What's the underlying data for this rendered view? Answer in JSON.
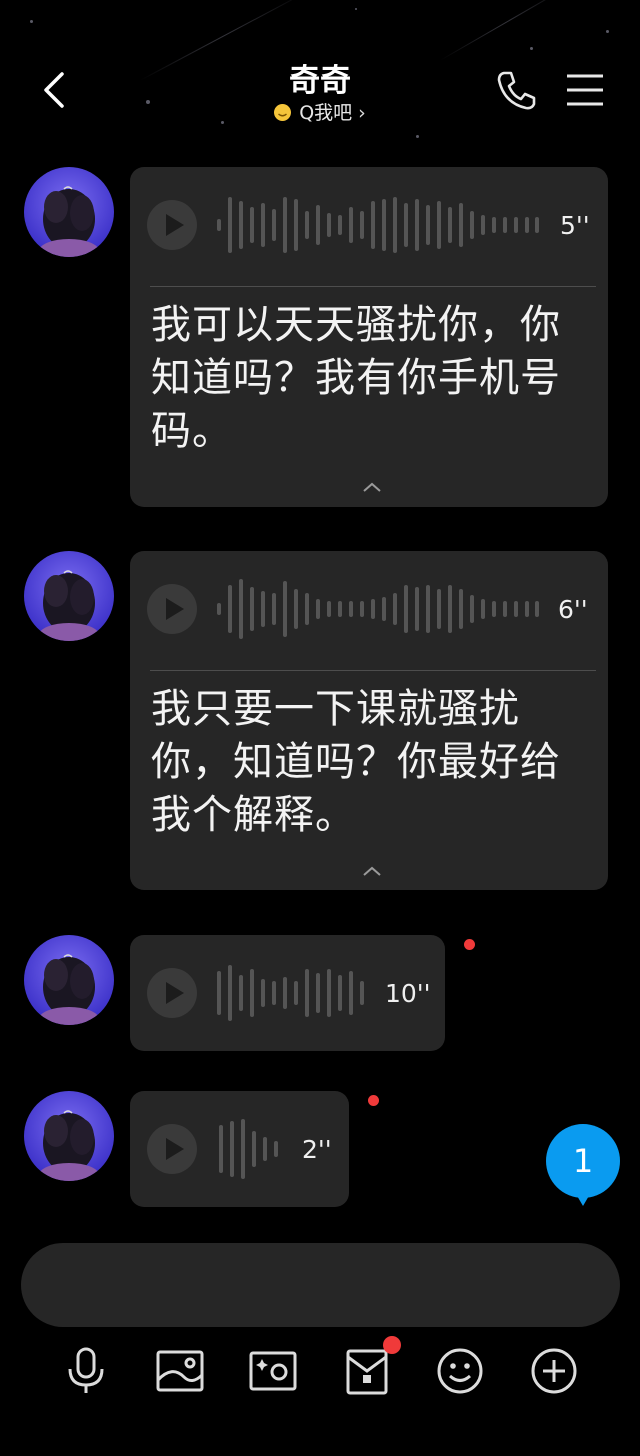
{
  "header": {
    "title": "奇奇",
    "subtitle": "Q我吧",
    "back_icon": "chevron-left-icon",
    "phone_icon": "phone-icon",
    "menu_icon": "hamburger-menu-icon"
  },
  "messages": [
    {
      "type": "voice",
      "duration": "5''",
      "transcript": "我可以天天骚扰你，你知道吗？我有你手机号码。",
      "unread": false
    },
    {
      "type": "voice",
      "duration": "6''",
      "transcript": "我只要一下课就骚扰你，知道吗？你最好给我个解释。",
      "unread": false
    },
    {
      "type": "voice",
      "duration": "10''",
      "transcript": "",
      "unread": true
    },
    {
      "type": "voice",
      "duration": "2''",
      "transcript": "",
      "unread": true
    }
  ],
  "new_message_badge": "1",
  "input": {
    "placeholder": ""
  },
  "toolbar": {
    "items": [
      "microphone-icon",
      "photo-icon",
      "camera-icon",
      "red-packet-icon",
      "emoji-icon",
      "plus-icon"
    ]
  },
  "colors": {
    "background": "#000000",
    "bubble": "#262626",
    "badge_blue": "#0a9bf0",
    "unread_red": "#f03a3a",
    "status_yellow": "#f5c53a"
  }
}
